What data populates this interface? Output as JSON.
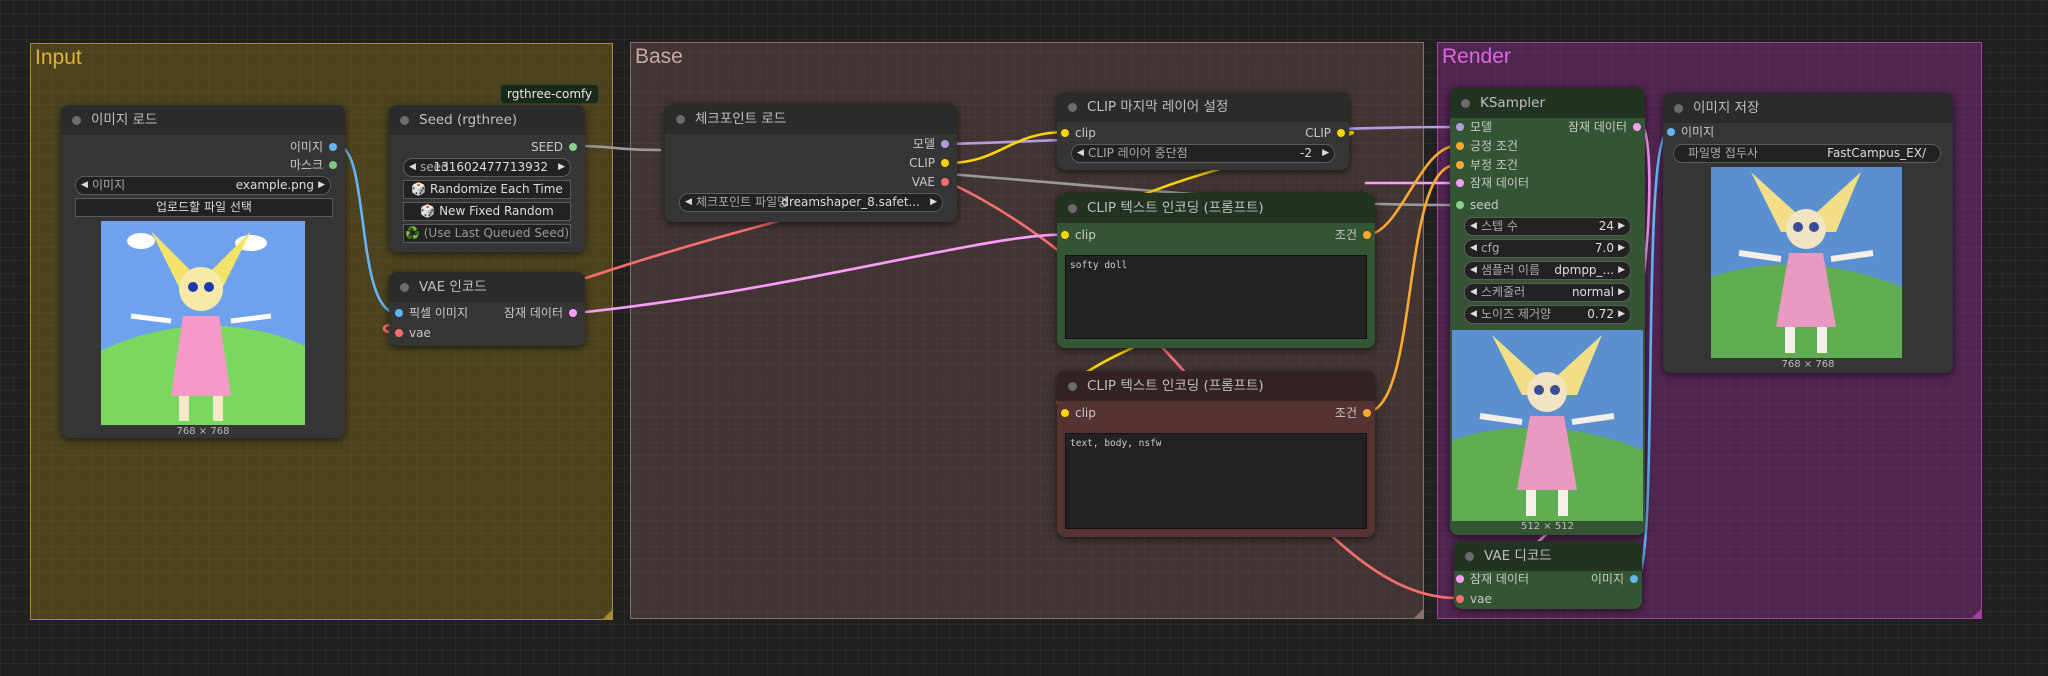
{
  "groups": {
    "input": "Input",
    "base": "Base",
    "render": "Render"
  },
  "badge": "rgthree-comfy",
  "nodes": {
    "load_image": {
      "title": "이미지 로드",
      "outputs": [
        "이미지",
        "마스크"
      ],
      "image_widget": {
        "label": "이미지",
        "value": "example.png"
      },
      "upload_button": "업로드할 파일 선택",
      "image_caption": "768 × 768"
    },
    "seed": {
      "title": "Seed (rgthree)",
      "output": "SEED",
      "seed_widget": {
        "label": "seed",
        "value": "131602477713932"
      },
      "buttons": [
        "🎲 Randomize Each Time",
        "🎲 New Fixed Random",
        "♻️ (Use Last Queued Seed)"
      ]
    },
    "vae_encode": {
      "title": "VAE 인코드",
      "inputs": [
        "픽셀 이미지",
        "vae"
      ],
      "output": "잠재 데이터"
    },
    "checkpoint": {
      "title": "체크포인트 로드",
      "outputs": [
        "모델",
        "CLIP",
        "VAE"
      ],
      "widget": {
        "label": "체크포인트 파일명",
        "value": "dreamshaper_8.safet..."
      }
    },
    "clip_skip": {
      "title": "CLIP 마지막 레이어 설정",
      "input": "clip",
      "output": "CLIP",
      "widget": {
        "label": "CLIP 레이어 중단점",
        "value": "-2"
      }
    },
    "clip_pos": {
      "title": "CLIP 텍스트 인코딩 (프롬프트)",
      "input": "clip",
      "output": "조건",
      "text": "softy doll"
    },
    "clip_neg": {
      "title": "CLIP 텍스트 인코딩 (프롬프트)",
      "input": "clip",
      "output": "조건",
      "text": "text, body, nsfw"
    },
    "ksampler": {
      "title": "KSampler",
      "inputs": [
        "모델",
        "긍정 조건",
        "부정 조건",
        "잠재 데이터",
        "seed"
      ],
      "output": "잠재 데이터",
      "widgets": [
        {
          "label": "스텝 수",
          "value": "24"
        },
        {
          "label": "cfg",
          "value": "7.0"
        },
        {
          "label": "샘플러 이름",
          "value": "dpmpp_..."
        },
        {
          "label": "스케줄러",
          "value": "normal"
        },
        {
          "label": "노이즈 제거양",
          "value": "0.72"
        }
      ],
      "image_caption": "512 × 512"
    },
    "vae_decode": {
      "title": "VAE 디코드",
      "inputs": [
        "잠재 데이터",
        "vae"
      ],
      "output": "이미지"
    },
    "save_image": {
      "title": "이미지 저장",
      "input": "이미지",
      "widget": {
        "label": "파일명 접두사",
        "value": "FastCampus_EX/"
      },
      "image_caption": "768 × 768"
    }
  },
  "colors": {
    "image": "#64b5f6",
    "mask": "#81c784",
    "latent": "#ff9cf9",
    "vae": "#ff6e6e",
    "clip": "#ffd500",
    "model": "#b39ddb",
    "conditioning": "#ffa931",
    "int": "#8ad08a"
  }
}
